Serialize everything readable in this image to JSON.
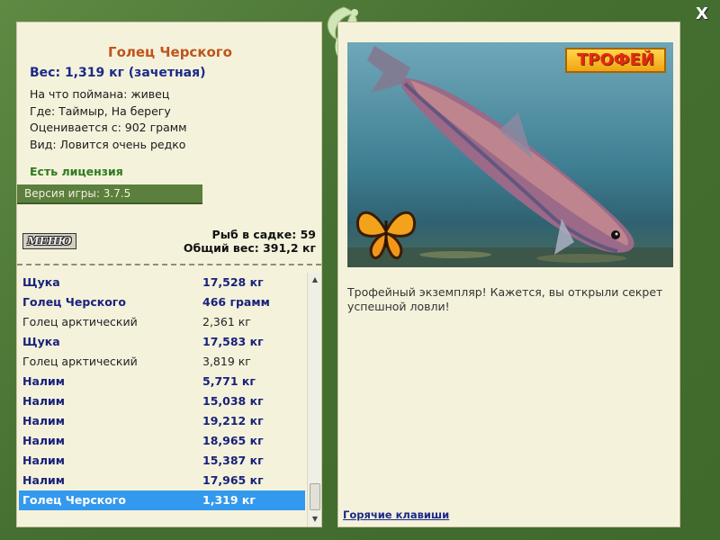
{
  "window": {
    "close_label": "X",
    "accent_color": "#4f7a3a"
  },
  "fish": {
    "title": "Голец Черского",
    "weight": "Вес: 1,319 кг (зачетная)",
    "caught_on": "На что поймана: живец",
    "location": "Где: Таймыр, На берегу",
    "valued_from": "Оценивается с: 902 грамм",
    "rarity": "Вид: Ловится очень редко"
  },
  "license": "Есть лицензия",
  "version": "Версия игры: 3.7.5",
  "menu_button": "МЕНЮ",
  "stats": {
    "fish_in_keepnet": "Рыб в садке: 59",
    "total_weight": "Общий вес: 391,2 кг"
  },
  "catch_list": [
    {
      "name": "Щука",
      "weight": "17,528 кг",
      "style": "bold"
    },
    {
      "name": "Голец Черского",
      "weight": "466 грамм",
      "style": "bold"
    },
    {
      "name": "Голец арктический",
      "weight": "2,361 кг",
      "style": "normal"
    },
    {
      "name": "Щука",
      "weight": "17,583 кг",
      "style": "bold"
    },
    {
      "name": "Голец арктический",
      "weight": "3,819 кг",
      "style": "normal"
    },
    {
      "name": "Налим",
      "weight": "5,771 кг",
      "style": "bold"
    },
    {
      "name": "Налим",
      "weight": "15,038 кг",
      "style": "bold"
    },
    {
      "name": "Налим",
      "weight": "19,212 кг",
      "style": "bold"
    },
    {
      "name": "Налим",
      "weight": "18,965 кг",
      "style": "bold"
    },
    {
      "name": "Налим",
      "weight": "15,387 кг",
      "style": "bold"
    },
    {
      "name": "Налим",
      "weight": "17,965 кг",
      "style": "bold"
    },
    {
      "name": "Голец Черского",
      "weight": "1,319 кг",
      "style": "selected"
    }
  ],
  "trophy_badge": "ТРОФЕЙ",
  "description": "Трофейный экземпляр! Кажется, вы открыли секрет успешной ловли!",
  "hotkeys_link": "Горячие клавиши"
}
